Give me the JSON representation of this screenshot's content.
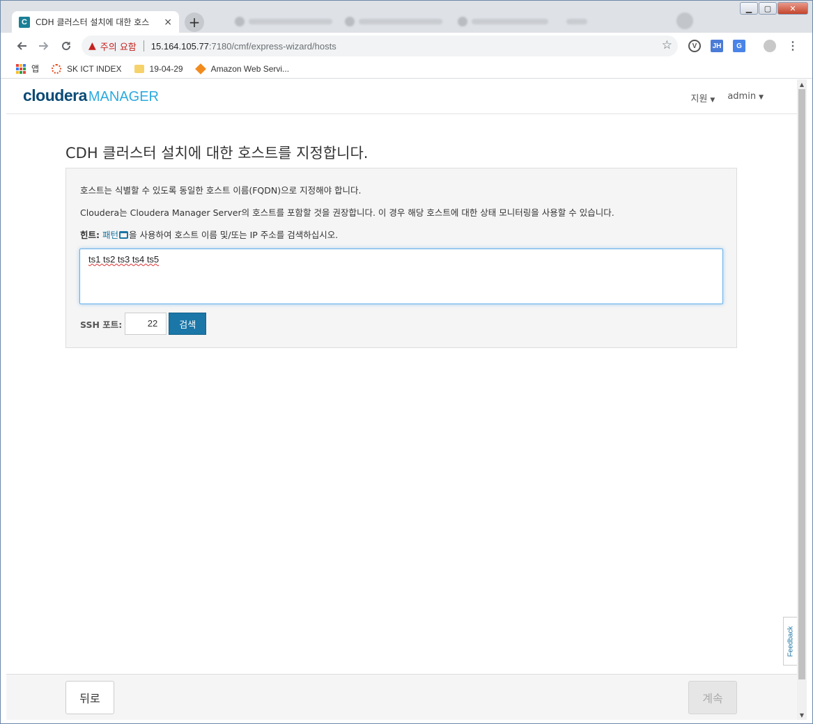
{
  "browser": {
    "active_tab_title": "CDH 클러스터 설치에 대한 호스",
    "tab_close": "×",
    "new_tab": "+",
    "security_warning": "주의 요함",
    "url_host": "15.164.105.77",
    "url_path": ":7180/cmf/express-wizard/hosts",
    "window_controls": {
      "minimize": "▁",
      "maximize": "▢",
      "close": "✕"
    },
    "extensions": {
      "v": "V",
      "jh": "JH",
      "g": "G"
    }
  },
  "bookmarks": [
    {
      "label": "앱",
      "icon": "apps-icon"
    },
    {
      "label": "SK ICT INDEX",
      "icon": "sk-icon"
    },
    {
      "label": "19-04-29",
      "icon": "folder-icon"
    },
    {
      "label": "Amazon Web Servi...",
      "icon": "aws-icon"
    }
  ],
  "header": {
    "logo_main": "cloudera",
    "logo_sub": "MANAGER",
    "nav": {
      "support": "지원",
      "user": "admin"
    }
  },
  "wizard": {
    "title": "CDH 클러스터 설치에 대한 호스트를 지정합니다.",
    "line1": "호스트는 식별할 수 있도록 동일한 호스트 이름(FQDN)으로 지정해야 합니다.",
    "line2": "Cloudera는 Cloudera Manager Server의 호스트를 포함할 것을 권장합니다. 이 경우 해당 호스트에 대한 상태 모니터링을 사용할 수 있습니다.",
    "hint_label": "힌트:",
    "hint_link": "패턴",
    "hint_rest": "을 사용하여 호스트 이름 및/또는 IP 주소를 검색하십시오.",
    "hosts_value": "ts1 ts2 ts3 ts4 ts5",
    "ssh_label": "SSH 포트:",
    "ssh_port": "22",
    "search_label": "검색"
  },
  "feedback_label": "Feedback",
  "footer": {
    "back_label": "뒤로",
    "continue_label": "계속"
  },
  "colors": {
    "accent": "#1a77a8",
    "logo_dark": "#0a4a75",
    "logo_light": "#2baadf",
    "warning": "#c5221f"
  }
}
